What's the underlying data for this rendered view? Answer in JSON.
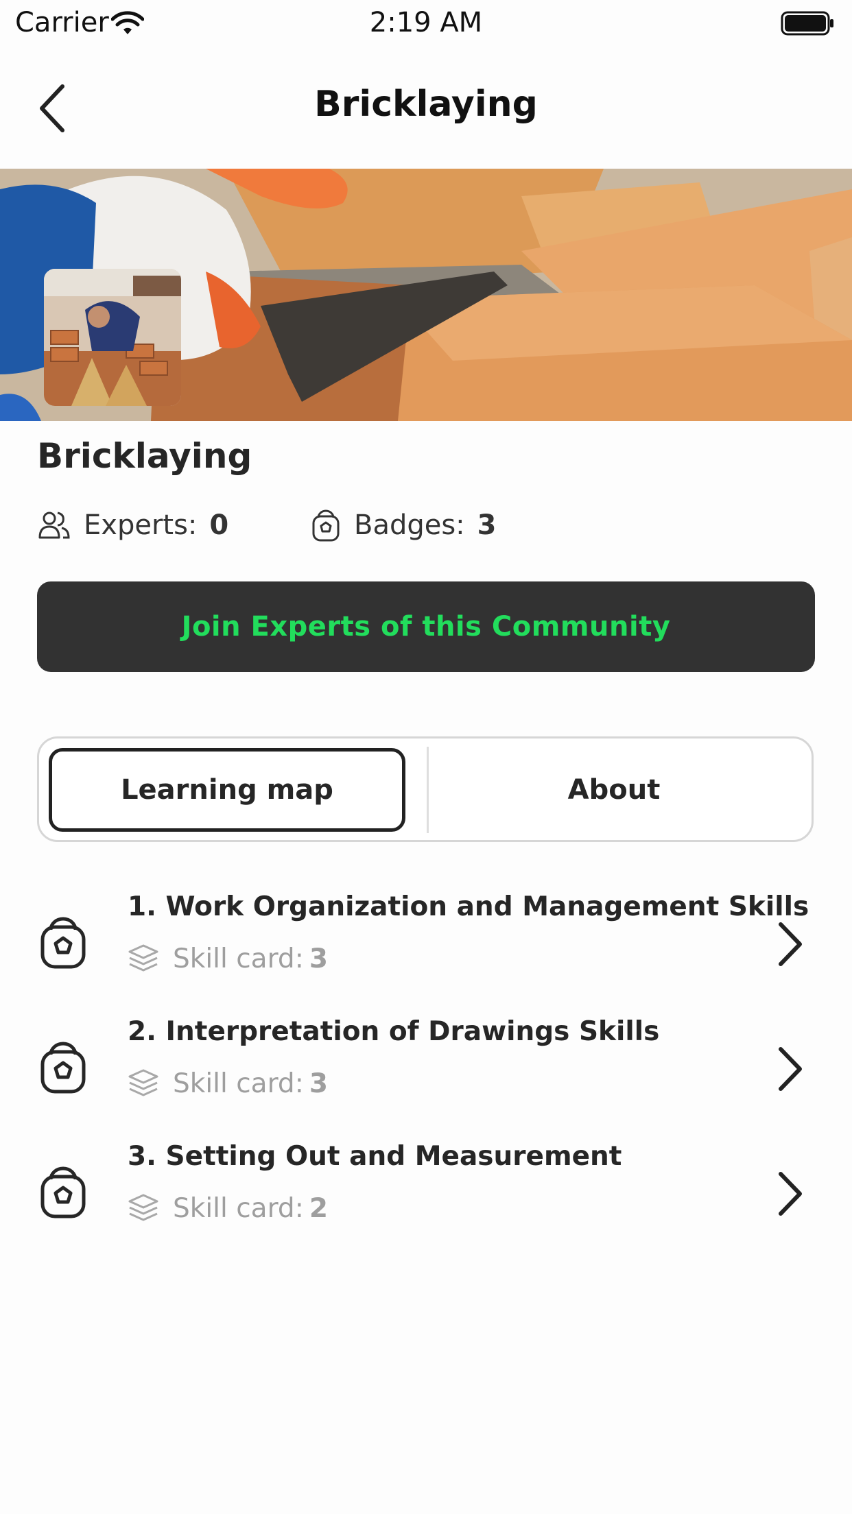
{
  "status_bar": {
    "carrier": "Carrier",
    "time": "2:19 AM"
  },
  "navbar": {
    "title": "Bricklaying",
    "back_icon": "chevron-left-icon"
  },
  "community": {
    "name": "Bricklaying",
    "experts_label": "Experts:",
    "experts_value": "0",
    "badges_label": "Badges:",
    "badges_value": "3",
    "join_label": "Join Experts of this Community",
    "join_color": "#22dd5c"
  },
  "tabs": {
    "items": [
      {
        "label": "Learning map",
        "active": true
      },
      {
        "label": "About",
        "active": false
      }
    ]
  },
  "learning_map": {
    "items": [
      {
        "title": "1. Work Organization and Management Skills",
        "skill_label": "Skill card:",
        "skill_count": "3"
      },
      {
        "title": "2. Interpretation of Drawings Skills",
        "skill_label": "Skill card:",
        "skill_count": "3"
      },
      {
        "title": "3. Setting Out and Measurement",
        "skill_label": "Skill card:",
        "skill_count": "2"
      }
    ]
  }
}
